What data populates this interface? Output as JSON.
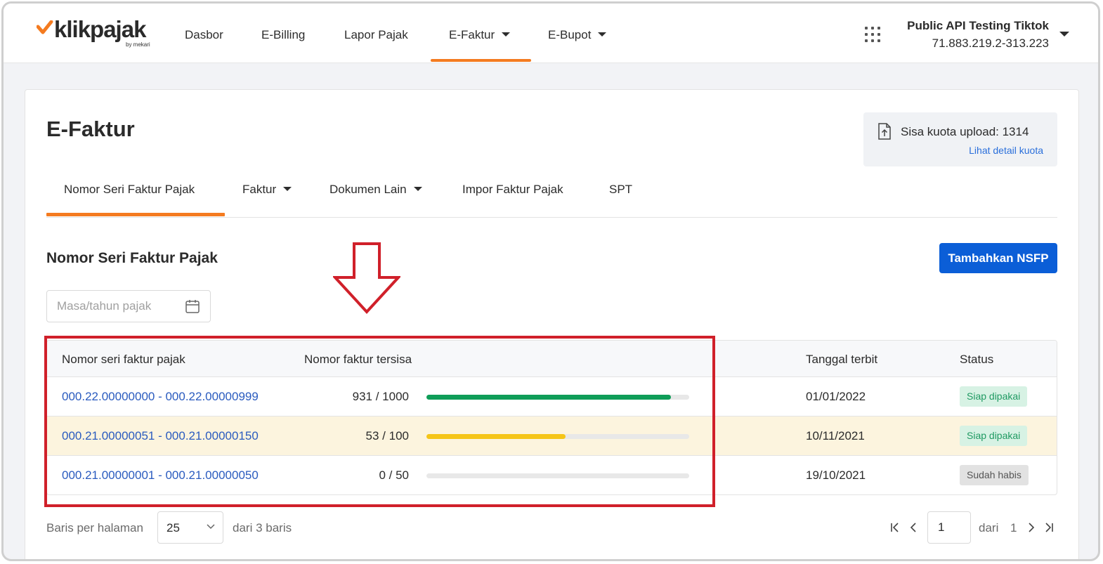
{
  "brand": {
    "logo_text": "klikpajak",
    "logo_sub": "by mekari",
    "accent": "#f47b20"
  },
  "nav": {
    "items": [
      {
        "label": "Dasbor"
      },
      {
        "label": "E-Billing"
      },
      {
        "label": "Lapor Pajak"
      },
      {
        "label": "E-Faktur"
      },
      {
        "label": "E-Bupot"
      }
    ]
  },
  "account": {
    "name": "Public API Testing Tiktok",
    "npwp": "71.883.219.2-313.223"
  },
  "page": {
    "title": "E-Faktur"
  },
  "quota": {
    "text": "Sisa kuota upload: 1314",
    "link": "Lihat detail kuota"
  },
  "tabs": [
    {
      "label": "Nomor Seri Faktur Pajak"
    },
    {
      "label": "Faktur"
    },
    {
      "label": "Dokumen Lain"
    },
    {
      "label": "Impor Faktur Pajak"
    },
    {
      "label": "SPT"
    }
  ],
  "section": {
    "title": "Nomor Seri Faktur Pajak",
    "add_button": "Tambahkan NSFP"
  },
  "filter": {
    "placeholder": "Masa/tahun pajak"
  },
  "table": {
    "headers": [
      "Nomor seri faktur pajak",
      "Nomor faktur tersisa",
      "Tanggal terbit",
      "Status"
    ],
    "rows": [
      {
        "range": "000.22.00000000 - 000.22.00000999",
        "remaining": "931 / 1000",
        "ratio": 0.931,
        "bar_color": "#0f9d58",
        "date": "01/01/2022",
        "status": "Siap dipakai",
        "status_bg": "#d7f2e4",
        "status_color": "#1f9a62"
      },
      {
        "range": "000.21.00000051 - 000.21.00000150",
        "remaining": "53 / 100",
        "ratio": 0.53,
        "bar_color": "#f5c518",
        "date": "10/11/2021",
        "status": "Siap dipakai",
        "status_bg": "#d7f2e4",
        "status_color": "#1f9a62"
      },
      {
        "range": "000.21.00000001 - 000.21.00000050",
        "remaining": "0 / 50",
        "ratio": 0,
        "bar_color": "#cccccc",
        "date": "19/10/2021",
        "status": "Sudah habis",
        "status_bg": "#e2e2e2",
        "status_color": "#555555"
      }
    ]
  },
  "pagination": {
    "rows_label": "Baris per halaman",
    "per_page": "25",
    "total_label": "dari 3 baris",
    "page_value": "1",
    "of_label": "dari",
    "total_pages": "1"
  }
}
